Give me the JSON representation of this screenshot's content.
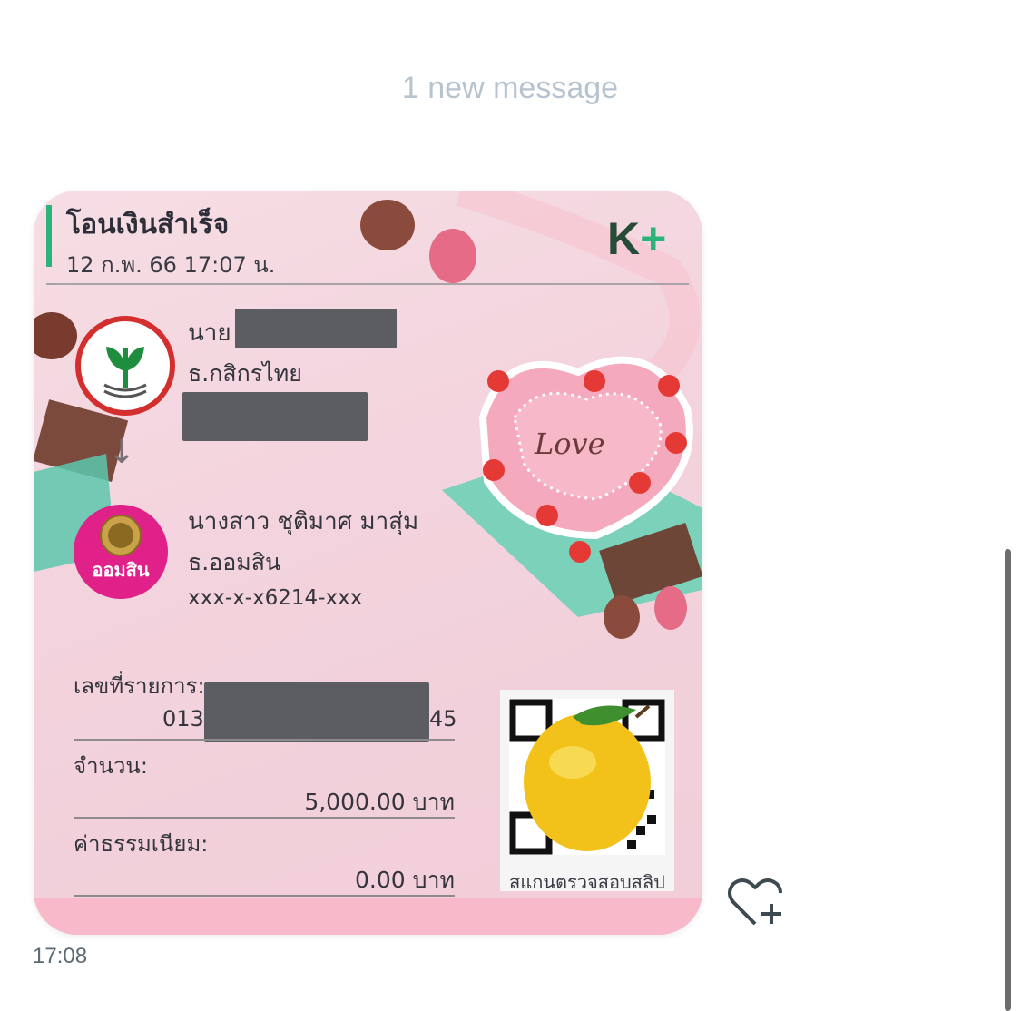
{
  "divider": {
    "text": "1 new message"
  },
  "slip": {
    "title": "โอนเงินสำเร็จ",
    "datetime": "12 ก.พ. 66  17:07 น.",
    "brand_logo": "K+",
    "sender": {
      "name": "นาย",
      "bank": "ธ.กสิกรไทย",
      "logo_text": ""
    },
    "receiver": {
      "name": "นางสาว ชุติมาศ มาสุ่ม",
      "bank": "ธ.ออมสิน",
      "account": "xxx-x-x6214-xxx",
      "logo_text": "ออมสิน"
    },
    "ref": {
      "label": "เลขที่รายการ:",
      "prefix": "013",
      "suffix": "45"
    },
    "amount": {
      "label": "จำนวน:",
      "value": "5,000.00 บาท"
    },
    "fee": {
      "label": "ค่าธรรมเนียม:",
      "value": "0.00 บาท"
    },
    "qr_label": "สแกนตรวจสอบสลิป",
    "decor_text": "Love"
  },
  "message": {
    "time": "17:08"
  },
  "colors": {
    "accent": "#2bb47a",
    "kbank_red": "#d32f2f",
    "gsb_pink": "#e0218a",
    "card_bg": "#f3d3dd"
  }
}
